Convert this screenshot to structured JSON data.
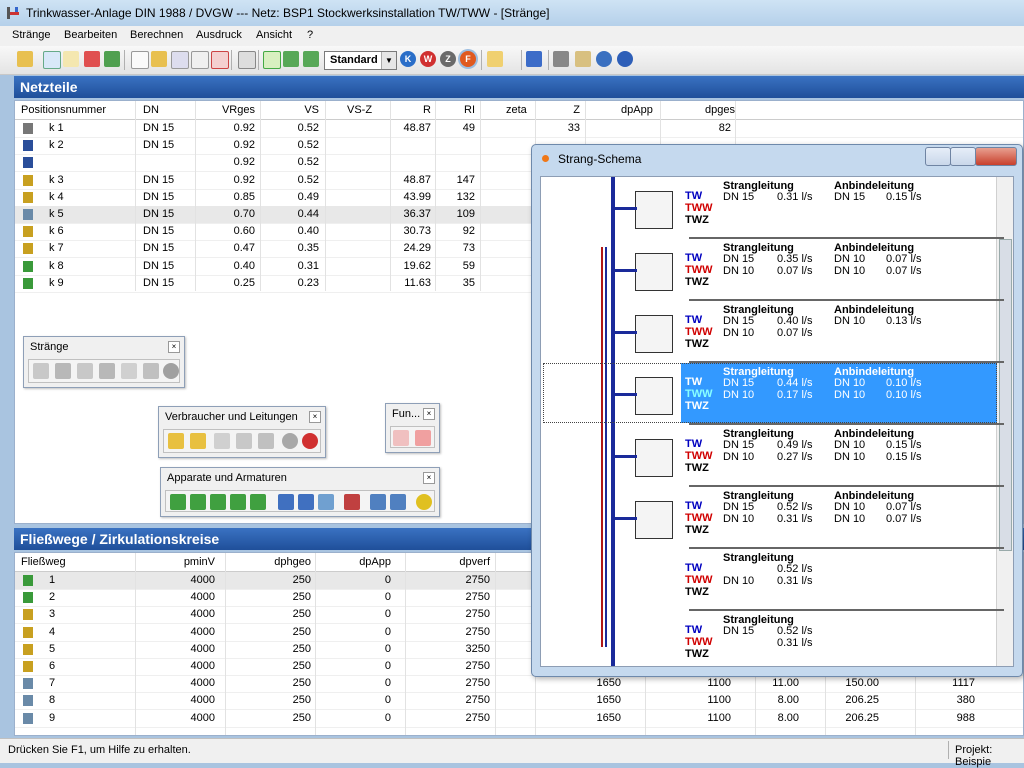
{
  "window": {
    "title": "Trinkwasser-Anlage DIN 1988 / DVGW --- Netz: BSP1 Stockwerksinstallation TW/TWW - [Stränge]"
  },
  "menu": [
    "Stränge",
    "Bearbeiten",
    "Berechnen",
    "Ausdruck",
    "Ansicht",
    "?"
  ],
  "toolbar": {
    "combo_value": "Standard"
  },
  "netzteile": {
    "title": "Netzteile",
    "columns": [
      "Positionsnummer",
      "DN",
      "VRges",
      "VS",
      "VS-Z",
      "R",
      "RI",
      "zeta",
      "Z",
      "dpApp",
      "dpges"
    ],
    "rows": [
      {
        "icon": "pipe-icon",
        "pos": "k 1",
        "dn": "DN 15",
        "vrges": "0.92",
        "vs": "0.52",
        "vsz": "",
        "r": "48.87",
        "ri": "49",
        "zeta": "",
        "z": "33",
        "dpapp": "",
        "dpges": "82"
      },
      {
        "icon": "valve-icon",
        "pos": "k 2",
        "dn": "DN 15",
        "vrges": "0.92",
        "vs": "0.52",
        "vsz": "",
        "r": "",
        "ri": "",
        "zeta": "",
        "z": "",
        "dpapp": "",
        "dpges": ""
      },
      {
        "icon": "valve-icon",
        "pos": "",
        "dn": "",
        "vrges": "0.92",
        "vs": "0.52",
        "vsz": "",
        "r": "",
        "ri": "",
        "zeta": "",
        "z": "",
        "dpapp": "",
        "dpges": ""
      },
      {
        "icon": "tap-icon",
        "pos": "k 3",
        "dn": "DN 15",
        "vrges": "0.92",
        "vs": "0.52",
        "vsz": "",
        "r": "48.87",
        "ri": "147",
        "zeta": "",
        "z": "",
        "dpapp": "",
        "dpges": ""
      },
      {
        "icon": "tap-icon",
        "pos": "k 4",
        "dn": "DN 15",
        "vrges": "0.85",
        "vs": "0.49",
        "vsz": "",
        "r": "43.99",
        "ri": "132",
        "zeta": "",
        "z": "",
        "dpapp": "",
        "dpges": ""
      },
      {
        "icon": "shower-icon",
        "pos": "k 5",
        "dn": "DN 15",
        "vrges": "0.70",
        "vs": "0.44",
        "vsz": "",
        "r": "36.37",
        "ri": "109",
        "zeta": "",
        "z": "",
        "dpapp": "",
        "dpges": ""
      },
      {
        "icon": "tap-icon",
        "pos": "k 6",
        "dn": "DN 15",
        "vrges": "0.60",
        "vs": "0.40",
        "vsz": "",
        "r": "30.73",
        "ri": "92",
        "zeta": "",
        "z": "",
        "dpapp": "",
        "dpges": ""
      },
      {
        "icon": "tap-icon",
        "pos": "k 7",
        "dn": "DN 15",
        "vrges": "0.47",
        "vs": "0.35",
        "vsz": "",
        "r": "24.29",
        "ri": "73",
        "zeta": "",
        "z": "",
        "dpapp": "",
        "dpges": ""
      },
      {
        "icon": "heater-icon",
        "pos": "k 8",
        "dn": "DN 15",
        "vrges": "0.40",
        "vs": "0.31",
        "vsz": "",
        "r": "19.62",
        "ri": "59",
        "zeta": "",
        "z": "",
        "dpapp": "",
        "dpges": ""
      },
      {
        "icon": "heater-icon",
        "pos": "k 9",
        "dn": "DN 15",
        "vrges": "0.25",
        "vs": "0.23",
        "vsz": "",
        "r": "11.63",
        "ri": "35",
        "zeta": "",
        "z": "",
        "dpapp": "",
        "dpges": ""
      }
    ]
  },
  "palettes": {
    "straenge": {
      "title": "Stränge"
    },
    "verbraucher": {
      "title": "Verbraucher und Leitungen"
    },
    "fun": {
      "title": "Fun..."
    },
    "apparate": {
      "title": "Apparate und Armaturen"
    }
  },
  "fliesswege": {
    "title": "Fließwege / Zirkulationskreise",
    "columns": [
      "Fließweg",
      "pminV",
      "dphgeo",
      "dpApp",
      "dpverf"
    ],
    "rows": [
      {
        "icon": "heater-icon",
        "nr": "1",
        "pminv": "4000",
        "dphgeo": "250",
        "dpapp": "0",
        "dpverf": "2750",
        "c6": "",
        "c7": "",
        "c8": "",
        "c9": "",
        "c10": ""
      },
      {
        "icon": "heater-icon",
        "nr": "2",
        "pminv": "4000",
        "dphgeo": "250",
        "dpapp": "0",
        "dpverf": "2750",
        "c6": "",
        "c7": "",
        "c8": "",
        "c9": "",
        "c10": ""
      },
      {
        "icon": "tap-icon",
        "nr": "3",
        "pminv": "4000",
        "dphgeo": "250",
        "dpapp": "0",
        "dpverf": "2750",
        "c6": "",
        "c7": "",
        "c8": "",
        "c9": "",
        "c10": ""
      },
      {
        "icon": "tap-icon",
        "nr": "4",
        "pminv": "4000",
        "dphgeo": "250",
        "dpapp": "0",
        "dpverf": "2750",
        "c6": "",
        "c7": "",
        "c8": "",
        "c9": "",
        "c10": ""
      },
      {
        "icon": "tap-icon",
        "nr": "5",
        "pminv": "4000",
        "dphgeo": "250",
        "dpapp": "0",
        "dpverf": "3250",
        "c6": "",
        "c7": "",
        "c8": "",
        "c9": "",
        "c10": ""
      },
      {
        "icon": "tap-icon",
        "nr": "6",
        "pminv": "4000",
        "dphgeo": "250",
        "dpapp": "0",
        "dpverf": "2750",
        "c6": "",
        "c7": "",
        "c8": "",
        "c9": "",
        "c10": ""
      },
      {
        "icon": "shower-icon",
        "nr": "7",
        "pminv": "4000",
        "dphgeo": "250",
        "dpapp": "0",
        "dpverf": "2750",
        "c6": "1650",
        "c7": "1100",
        "c8": "11.00",
        "c9": "150.00",
        "c10": "1117"
      },
      {
        "icon": "shower-icon",
        "nr": "8",
        "pminv": "4000",
        "dphgeo": "250",
        "dpapp": "0",
        "dpverf": "2750",
        "c6": "1650",
        "c7": "1100",
        "c8": "8.00",
        "c9": "206.25",
        "c10": "380"
      },
      {
        "icon": "shower-icon",
        "nr": "9",
        "pminv": "4000",
        "dphgeo": "250",
        "dpapp": "0",
        "dpverf": "2750",
        "c6": "1650",
        "c7": "1100",
        "c8": "8.00",
        "c9": "206.25",
        "c10": "988"
      }
    ]
  },
  "schema": {
    "title": "Strang-Schema",
    "heading_strang": "Strangleitung",
    "heading_anbinde": "Anbindeleitung",
    "label_tw": "TW",
    "label_tww": "TWW",
    "label_twz": "TWZ",
    "blocks": [
      {
        "fixture": "stove-icon",
        "has_anbinde": true,
        "s_tw_dn": "DN 15",
        "s_tw_v": "0.31 l/s",
        "s_tww_dn": "",
        "s_tww_v": "",
        "a_tw_dn": "DN 15",
        "a_tw_v": "0.15 l/s",
        "a_tww_dn": "",
        "a_tww_v": ""
      },
      {
        "fixture": "sink-icon",
        "has_anbinde": true,
        "s_tw_dn": "DN 15",
        "s_tw_v": "0.35 l/s",
        "s_tww_dn": "DN 10",
        "s_tww_v": "0.07 l/s",
        "a_tw_dn": "DN 10",
        "a_tw_v": "0.07 l/s",
        "a_tww_dn": "DN 10",
        "a_tww_v": "0.07 l/s"
      },
      {
        "fixture": "wc-icon",
        "has_anbinde": true,
        "s_tw_dn": "DN 15",
        "s_tw_v": "0.40 l/s",
        "s_tww_dn": "DN 10",
        "s_tww_v": "0.07 l/s",
        "a_tw_dn": "DN 10",
        "a_tw_v": "0.13 l/s",
        "a_tww_dn": "",
        "a_tww_v": ""
      },
      {
        "fixture": "shower-icon",
        "has_anbinde": true,
        "s_tw_dn": "DN 15",
        "s_tw_v": "0.44 l/s",
        "s_tww_dn": "DN 10",
        "s_tww_v": "0.17 l/s",
        "a_tw_dn": "DN 10",
        "a_tw_v": "0.10 l/s",
        "a_tww_dn": "DN 10",
        "a_tww_v": "0.10 l/s"
      },
      {
        "fixture": "bathtub-icon",
        "has_anbinde": true,
        "s_tw_dn": "DN 15",
        "s_tw_v": "0.49 l/s",
        "s_tww_dn": "DN 10",
        "s_tww_v": "0.27 l/s",
        "a_tw_dn": "DN 10",
        "a_tw_v": "0.15 l/s",
        "a_tww_dn": "DN 10",
        "a_tww_v": "0.15 l/s"
      },
      {
        "fixture": "washbasin-icon",
        "has_anbinde": true,
        "s_tw_dn": "DN 15",
        "s_tw_v": "0.52 l/s",
        "s_tww_dn": "DN 10",
        "s_tww_v": "0.31 l/s",
        "a_tw_dn": "DN 10",
        "a_tw_v": "0.07 l/s",
        "a_tww_dn": "DN 10",
        "a_tww_v": "0.07 l/s"
      },
      {
        "fixture": "",
        "has_anbinde": false,
        "s_tw_dn": "",
        "s_tw_v": "0.52 l/s",
        "s_tww_dn": "DN 10",
        "s_tww_v": "0.31 l/s",
        "a_tw_dn": "",
        "a_tw_v": "",
        "a_tww_dn": "",
        "a_tww_v": ""
      },
      {
        "fixture": "",
        "has_anbinde": false,
        "s_tw_dn": "DN 15",
        "s_tw_v": "0.52 l/s",
        "s_tww_dn": "",
        "s_tww_v": "0.31 l/s",
        "a_tw_dn": "",
        "a_tw_v": "",
        "a_tww_dn": "",
        "a_tww_v": ""
      }
    ],
    "selected_index": 3
  },
  "status": {
    "help": "Drücken Sie F1, um Hilfe zu erhalten.",
    "project": "Projekt: Beispie"
  },
  "colors": {
    "accent": "#1f4f9a",
    "selection": "#3399ff",
    "tw": "#0000c0",
    "tww": "#d00000"
  }
}
